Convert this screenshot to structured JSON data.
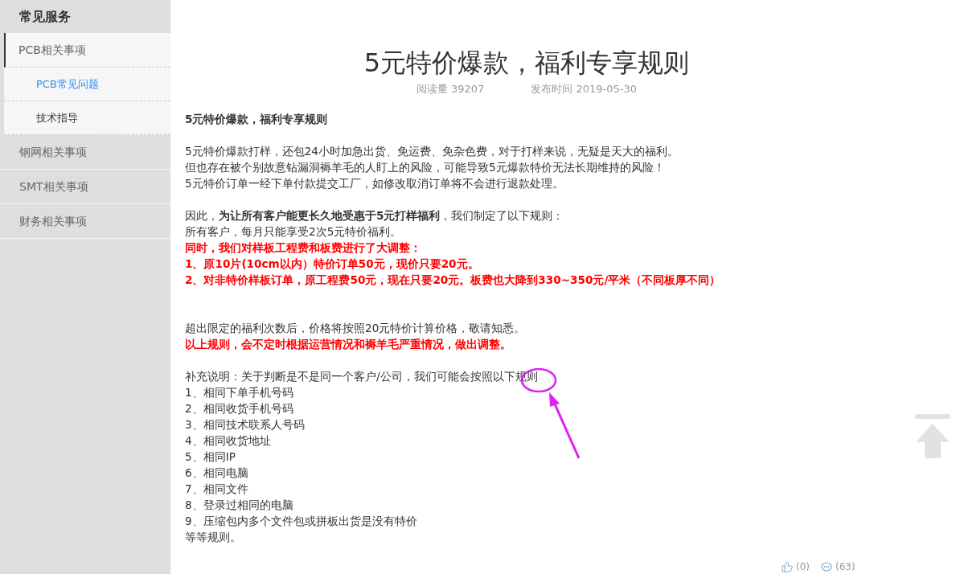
{
  "sidebar": {
    "title": "常见服务",
    "items": [
      {
        "label": "PCB相关事项",
        "expanded": true,
        "children": [
          {
            "label": "PCB常见问题",
            "selected": true
          },
          {
            "label": "技术指导",
            "selected": false
          }
        ]
      },
      {
        "label": "钢网相关事项",
        "expanded": false
      },
      {
        "label": "SMT相关事项",
        "expanded": false
      },
      {
        "label": "财务相关事项",
        "expanded": false
      }
    ]
  },
  "article": {
    "title": "5元特价爆款，福利专享规则",
    "reads": "阅读量 39207",
    "published": "发布时间 2019-05-30",
    "lines": [
      {
        "kind": "bold",
        "text": "5元特价爆款，福利专享规则"
      },
      {
        "kind": "blank"
      },
      {
        "kind": "plain",
        "text": "5元特价爆款打样，还包24小时加急出货、免运费、免杂色费，对于打样来说，无疑是天大的福利。"
      },
      {
        "kind": "plain",
        "text": "但也存在被个别故意钻漏洞褥羊毛的人盯上的风险，可能导致5元爆款特价无法长期维持的风险！"
      },
      {
        "kind": "plain",
        "text": "5元特价订单一经下单付款提交工厂，如修改取消订单将不会进行退款处理。"
      },
      {
        "kind": "blank"
      },
      {
        "kind": "plain",
        "text": "因此，**为让所有客户能更长久地受惠于5元打样福利**，我们制定了以下规则："
      },
      {
        "kind": "plain",
        "text": "所有客户，每月只能享受2次5元特价福利。"
      },
      {
        "kind": "red",
        "text": "同时，我们对样板工程费和板费进行了大调整："
      },
      {
        "kind": "red",
        "text": "1、原10片(10cm以内）特价订单50元，现价只要20元。"
      },
      {
        "kind": "red",
        "text": "2、对非特价样板订单，原工程费50元，现在只要20元。板费也大降到330~350元/平米（不同板厚不同）"
      },
      {
        "kind": "blank"
      },
      {
        "kind": "blank"
      },
      {
        "kind": "plain",
        "text": "超出限定的福利次数后，价格将按照20元特价计算价格，敬请知悉。"
      },
      {
        "kind": "red",
        "text": "以上规则，会不定时根据运营情况和褥羊毛严重情况，做出调整。"
      },
      {
        "kind": "blank"
      },
      {
        "kind": "plain",
        "text": "补充说明：关于判断是不是同一个客户/公司，我们可能会按照以下规则"
      },
      {
        "kind": "plain",
        "text": "1、相同下单手机号码"
      },
      {
        "kind": "plain",
        "text": "2、相同收货手机号码"
      },
      {
        "kind": "plain",
        "text": "3、相同技术联系人号码"
      },
      {
        "kind": "plain",
        "text": "4、相同收货地址"
      },
      {
        "kind": "plain",
        "text": "5、相同IP"
      },
      {
        "kind": "plain",
        "text": "6、相同电脑"
      },
      {
        "kind": "plain",
        "text": "7、相同文件"
      },
      {
        "kind": "plain",
        "text": "8、登录过相同的电脑"
      },
      {
        "kind": "plain",
        "text": "9、压缩包内多个文件包或拼板出货是没有特价"
      },
      {
        "kind": "plain",
        "text": "等等规则。"
      }
    ],
    "likes": "(0)",
    "comments": "(63)"
  }
}
